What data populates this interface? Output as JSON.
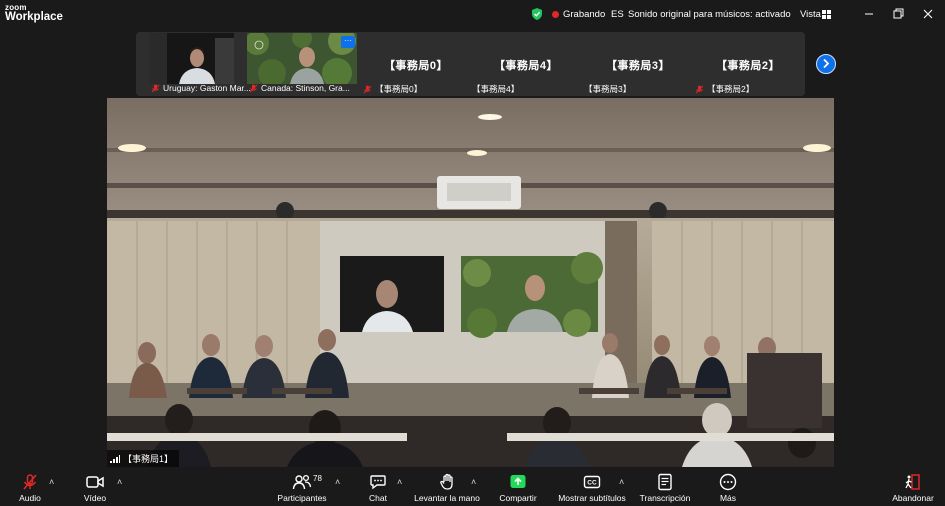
{
  "app": {
    "logo_line1": "zoom",
    "logo_line2": "Workplace"
  },
  "titlebar": {
    "recording_label": "Grabando",
    "language": "ES",
    "audio_mode": "Sonido original para músicos: activado",
    "view_label": "Vista"
  },
  "gallery": {
    "tiles": [
      {
        "label": "Uruguay: Gaston Mar..."
      },
      {
        "label": "Canada: Stinson, Gra..."
      },
      {
        "name": "【事務局0】",
        "label": "【事務局0】"
      },
      {
        "name": "【事務局4】",
        "label": "【事務局4】"
      },
      {
        "name": "【事務局3】",
        "label": "【事務局3】"
      },
      {
        "name": "【事務局2】",
        "label": "【事務局2】"
      }
    ]
  },
  "main": {
    "speaker_label": "【事務局1】"
  },
  "toolbar": {
    "audio": "Audio",
    "video": "Vídeo",
    "participants": "Participantes",
    "participants_count": "78",
    "chat": "Chat",
    "raise_hand": "Levantar la mano",
    "share": "Compartir",
    "captions": "Mostrar subtítulos",
    "transcript": "Transcripción",
    "more": "Más",
    "leave": "Abandonar"
  },
  "colors": {
    "accent": "#0e71eb",
    "share_green": "#23d959",
    "muted_red": "#e02828",
    "shield_green": "#22c55e"
  }
}
